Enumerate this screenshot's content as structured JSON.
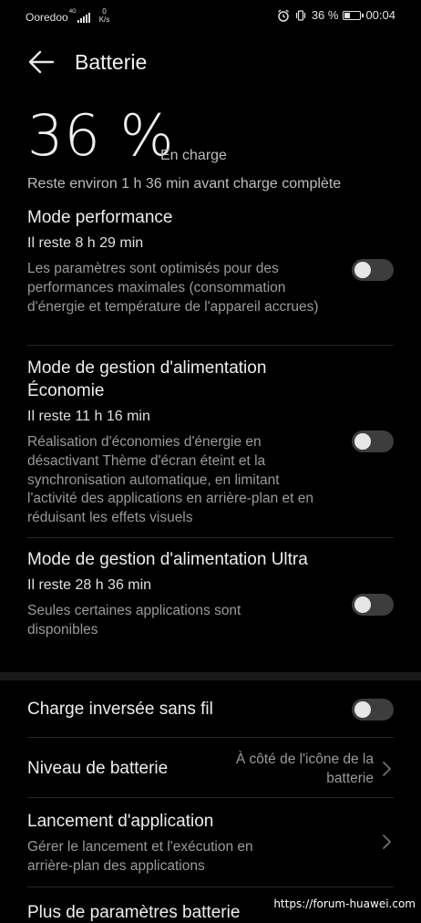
{
  "status_bar": {
    "carrier": "Ooredoo",
    "network": "4G",
    "speed_value": "0",
    "speed_unit": "K/s",
    "battery_percent": "36 %",
    "time": "00:04"
  },
  "header": {
    "title": "Batterie"
  },
  "summary": {
    "percent": "36 %",
    "state": "En charge",
    "remaining": "Reste environ 1 h 36 min avant charge complète"
  },
  "modes": [
    {
      "title": "Mode performance",
      "time": "Il reste 8 h 29 min",
      "desc": "Les paramètres sont optimisés pour des performances maximales (consommation d'énergie et température de l'appareil accrues)",
      "enabled": false
    },
    {
      "title": "Mode de gestion d'alimentation Économie",
      "time": "Il reste 11 h 16 min",
      "desc": "Réalisation d'économies d'énergie en désactivant Thème d'écran éteint et la synchronisation automatique, en limitant l'activité des applications en arrière-plan et en réduisant les effets visuels",
      "enabled": false
    },
    {
      "title": "Mode de gestion d'alimentation Ultra",
      "time": "Il reste 28 h 36 min",
      "desc": "Seules certaines applications sont disponibles",
      "enabled": false
    }
  ],
  "settings": {
    "reverse_charge": {
      "title": "Charge inversée sans fil",
      "enabled": false
    },
    "battery_level": {
      "title": "Niveau de batterie",
      "value": "À côté de l'icône de la batterie"
    },
    "app_launch": {
      "title": "Lancement d'application",
      "desc": "Gérer le lancement et l'exécution en arrière-plan des applications"
    },
    "more": {
      "title": "Plus de paramètres batterie"
    }
  },
  "watermark": "https://forum-huawei.com"
}
